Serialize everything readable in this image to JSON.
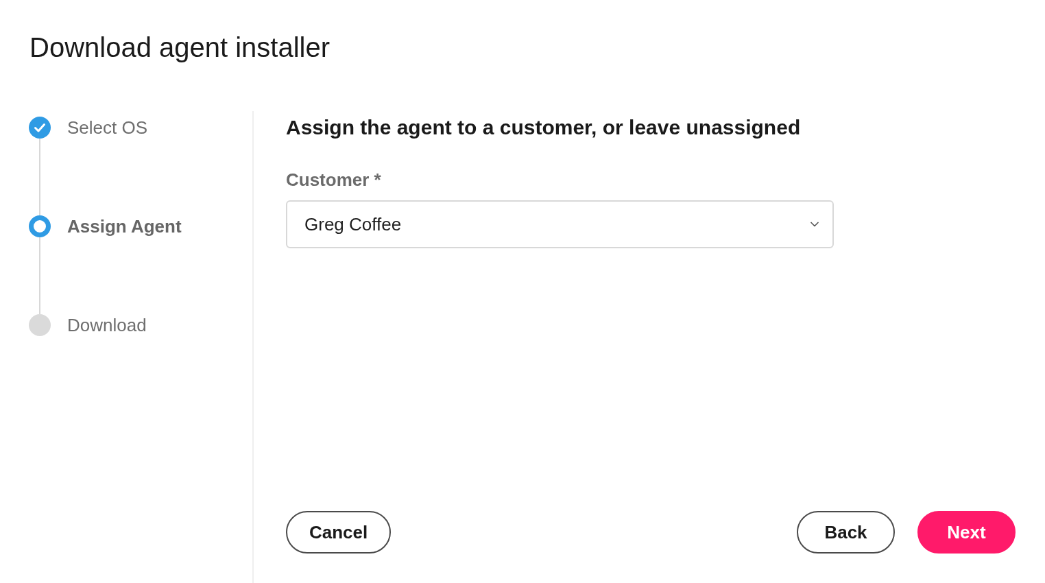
{
  "title": "Download agent installer",
  "steps": [
    {
      "label": "Select OS",
      "completed": true,
      "selected": false
    },
    {
      "label": "Assign Agent",
      "completed": false,
      "selected": true
    },
    {
      "label": "Download",
      "completed": false,
      "selected": false
    }
  ],
  "form": {
    "heading": "Assign the agent to a customer, or leave unassigned",
    "fields": [
      {
        "kind": "select",
        "label": "Customer *",
        "value": "Greg Coffee"
      }
    ]
  },
  "buttons_left": [
    {
      "label": "Cancel",
      "kind": "outline"
    }
  ],
  "buttons_right": [
    {
      "label": "Back",
      "kind": "outline"
    },
    {
      "label": "Next",
      "kind": "primary"
    }
  ]
}
